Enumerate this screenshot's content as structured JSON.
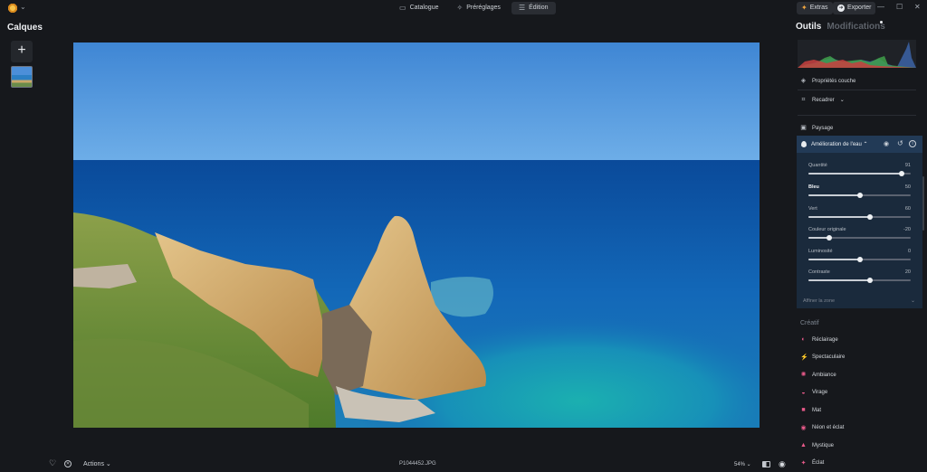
{
  "topbar": {
    "modes": [
      {
        "label": "Catalogue",
        "icon": "catalogue-icon",
        "active": false
      },
      {
        "label": "Préréglages",
        "icon": "presets-icon",
        "active": false
      },
      {
        "label": "Édition",
        "icon": "edit-sliders-icon",
        "active": true
      }
    ],
    "extras_label": "Extras",
    "export_label": "Exporter",
    "window_controls": [
      "minimize-icon",
      "maximize-icon",
      "close-icon"
    ]
  },
  "left_panel": {
    "title": "Calques",
    "add_layer_icon": "plus-icon"
  },
  "image": {
    "filename": "P1044452.JPG",
    "zoom": "54%"
  },
  "bottombar": {
    "actions_label": "Actions"
  },
  "right_panel": {
    "tabs": [
      "Outils",
      "Modifications"
    ],
    "layer_properties": "Propriétés couche",
    "crop": "Recadrer",
    "landscape": "Paysage",
    "water_tool": {
      "title": "Amélioration de l'eau",
      "sliders": [
        {
          "label": "Quantité",
          "value": "91",
          "level": 0.91,
          "bold": false
        },
        {
          "label": "Bleu",
          "value": "50",
          "level": 0.5,
          "bold": true
        },
        {
          "label": "Vert",
          "value": "60",
          "level": 0.6,
          "bold": false
        },
        {
          "label": "Couleur originale",
          "value": "-20",
          "level": 0.2,
          "bold": false
        },
        {
          "label": "Luminosité",
          "value": "0",
          "level": 0.5,
          "bold": false
        },
        {
          "label": "Contraste",
          "value": "20",
          "level": 0.6,
          "bold": false
        }
      ],
      "refine_label": "Affiner la zone"
    },
    "creative_title": "Créatif",
    "creative_items": [
      {
        "label": "Réclairage",
        "icon": "relight-icon",
        "color": "#e85a8a"
      },
      {
        "label": "Spectaculaire",
        "icon": "lightning-icon",
        "color": "#e85a8a"
      },
      {
        "label": "Ambiance",
        "icon": "ambiance-icon",
        "color": "#e85a8a"
      },
      {
        "label": "Virage",
        "icon": "toning-icon",
        "color": "#e85a8a"
      },
      {
        "label": "Mat",
        "icon": "matte-icon",
        "color": "#e85a8a"
      },
      {
        "label": "Néon et éclat",
        "icon": "neon-icon",
        "color": "#e85a8a"
      },
      {
        "label": "Mystique",
        "icon": "mystic-icon",
        "color": "#e85a8a"
      },
      {
        "label": "Éclat",
        "icon": "glow-icon",
        "color": "#e85a8a"
      }
    ]
  },
  "colors": {
    "accent": "#223a56",
    "background": "#16181c",
    "creative_icon": "#e85a8a"
  }
}
